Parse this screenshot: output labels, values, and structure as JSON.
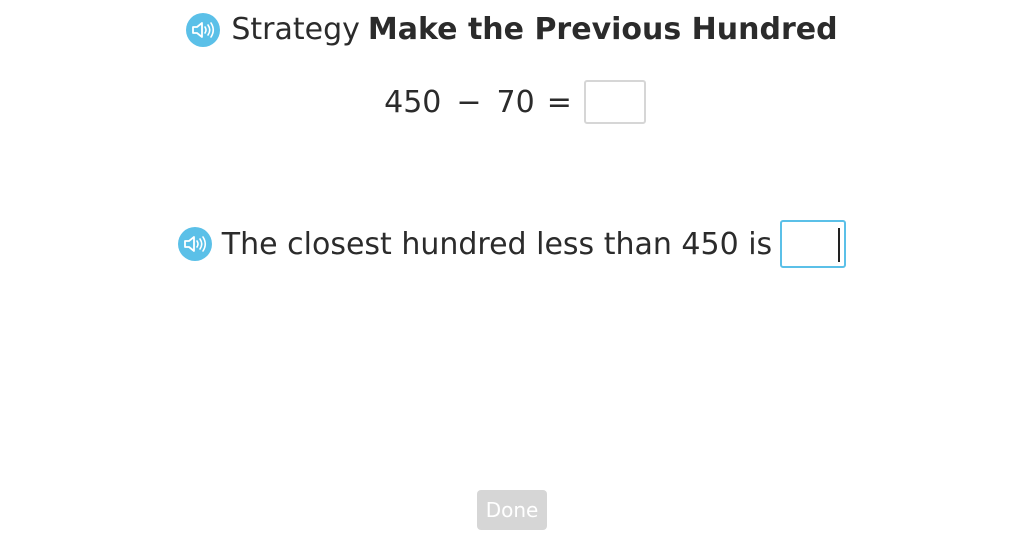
{
  "colors": {
    "accent": "#5bc0e8",
    "text": "#2b2b2b",
    "done_button_bg": "#d6d6d6",
    "answer_box_border": "#d6d6d6"
  },
  "header": {
    "icon": "speaker-icon",
    "prefix": "Strategy",
    "title": "Make the Previous Hundred"
  },
  "equation": {
    "operand1": "450",
    "operator": "−",
    "operand2": "70",
    "equals": "=",
    "answer_value": ""
  },
  "prompt": {
    "icon": "speaker-icon",
    "text": "The closest hundred less than 450 is",
    "input_value": ""
  },
  "done_button": {
    "label": "Done"
  }
}
